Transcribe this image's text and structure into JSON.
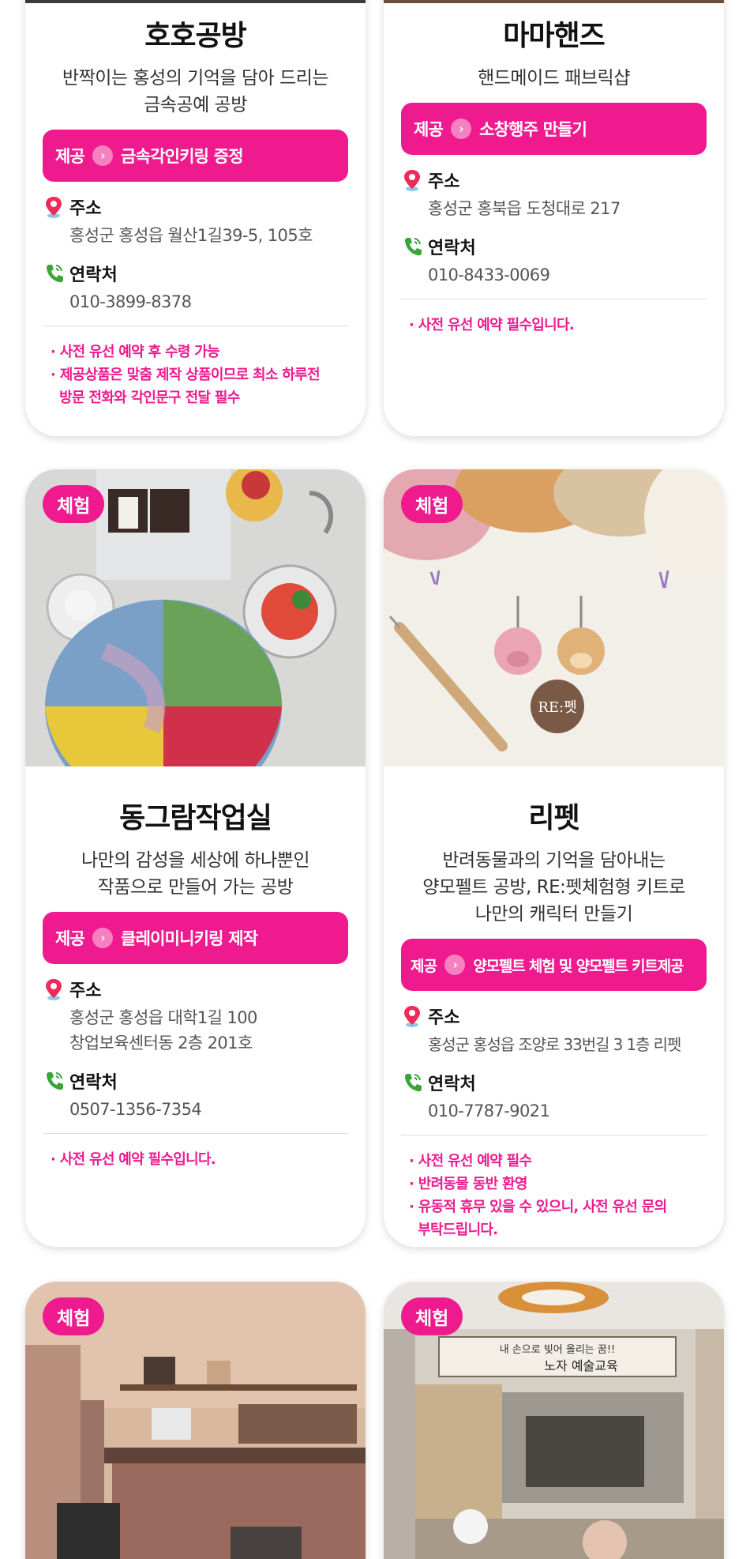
{
  "colors": {
    "accent": "#ee1a8e",
    "card_bg": "#ffffff"
  },
  "cards": [
    {
      "title": "호호공방",
      "desc": [
        "반짝이는 홍성의 기억을 담아 드리는",
        "금속공예 공방"
      ],
      "offer_label": "제공",
      "offer": "금속각인키링 증정",
      "address_label": "주소",
      "address": [
        "홍성군 홍성읍 월산1길39-5, 105호"
      ],
      "contact_label": "연락처",
      "contact": "010-3899-8378",
      "notes": [
        "· 사전 유선 예약 후 수령 가능",
        "· 제공상품은 맞춤 제작 상품이므로 최소 하루전",
        "  방문 전화와 각인문구 전달 필수"
      ]
    },
    {
      "title": "마마핸즈",
      "desc": [
        "핸드메이드 패브릭샵"
      ],
      "offer_label": "제공",
      "offer": "소창행주 만들기",
      "address_label": "주소",
      "address": [
        "홍성군 홍북읍 도청대로 217"
      ],
      "contact_label": "연락처",
      "contact": "010-8433-0069",
      "notes": [
        "· 사전 유선 예약 필수입니다."
      ]
    },
    {
      "tag": "체험",
      "title": "동그람작업실",
      "desc": [
        "나만의 감성을 세상에 하나뿐인",
        "작품으로 만들어 가는 공방"
      ],
      "offer_label": "제공",
      "offer": "클레이미니키링 제작",
      "address_label": "주소",
      "address": [
        "홍성군 홍성읍 대학1길 100",
        "창업보육센터동 2층 201호"
      ],
      "contact_label": "연락처",
      "contact": "0507-1356-7354",
      "notes": [
        "· 사전 유선 예약 필수입니다."
      ]
    },
    {
      "tag": "체험",
      "title": "리펫",
      "desc": [
        "반려동물과의 기억을 담아내는",
        "양모펠트 공방, RE:펫체험형 키트로",
        "나만의 캐릭터 만들기"
      ],
      "offer_label": "제공",
      "offer": "양모펠트 체험 및 양모펠트 키트제공",
      "address_label": "주소",
      "address": [
        "홍성군 홍성읍 조양로 33번길 3 1층 리펫"
      ],
      "contact_label": "연락처",
      "contact": "010-7787-9021",
      "notes": [
        "· 사전 유선 예약 필수",
        "· 반려동물 동반 환영",
        "· 유동적 휴무 있을 수 있으니, 사전 유선 문의",
        "  부탁드립니다."
      ],
      "photo_text": "RE:펫"
    },
    {
      "tag": "체험"
    },
    {
      "tag": "체험",
      "photo_banner": [
        "내 손으로 빚어 올리는 꿈!!",
        "노자 예술교육"
      ]
    }
  ]
}
